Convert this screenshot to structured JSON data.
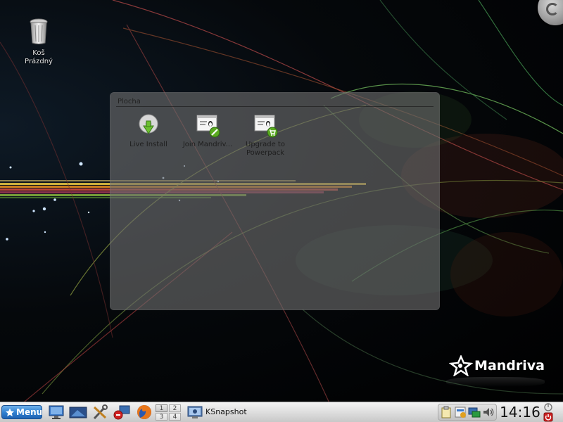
{
  "desktop": {
    "trash_label": "Koš\nPrázdný",
    "logo_text": "Mandriva"
  },
  "folderview": {
    "title": "Plocha",
    "items": [
      {
        "label": "Live Install",
        "icon": "live-install-icon"
      },
      {
        "label": "Join Mandriv...",
        "icon": "join-mandriva-icon"
      },
      {
        "label": "Upgrade to Powerpack",
        "icon": "upgrade-powerpack-icon"
      }
    ]
  },
  "panel": {
    "menu_label": "Menu",
    "launchers": [
      "show-desktop-icon",
      "monitor-icon",
      "system-settings-icon",
      "remote-desktop-icon",
      "firefox-icon"
    ],
    "pager": [
      "1",
      "2",
      "3",
      "4"
    ],
    "tasks": [
      {
        "label": "KSnapshot",
        "icon": "ksnapshot-icon"
      }
    ],
    "tray": [
      "clipboard-icon",
      "package-update-icon",
      "network-icon",
      "volume-icon"
    ],
    "clock": "14:16"
  },
  "colors": {
    "panel_bg": "#dcdcdc",
    "menu_button": "#2f7fd0",
    "folderview_bg": "#6e6e6e",
    "desktop_bg": "#000000"
  }
}
